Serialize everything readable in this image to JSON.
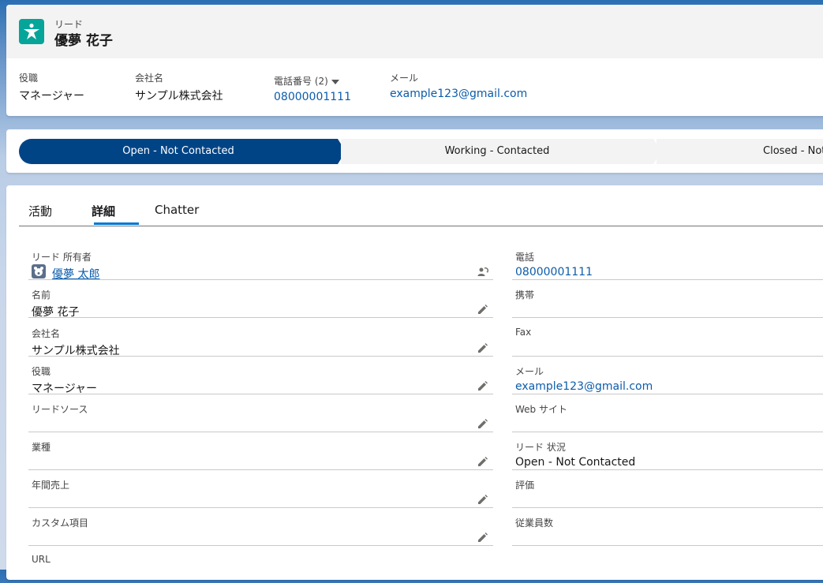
{
  "header": {
    "object_label": "リード",
    "record_name": "優夢 花子",
    "fields": [
      {
        "label": "役職",
        "value": "マネージャー"
      },
      {
        "label": "会社名",
        "value": "サンプル株式会社"
      },
      {
        "label": "電話番号 (2)",
        "value": "08000001111"
      },
      {
        "label": "メール",
        "value": "example123@gmail.com"
      }
    ]
  },
  "path": {
    "stages": [
      "Open - Not Contacted",
      "Working - Contacted",
      "Closed - Not"
    ]
  },
  "tabs": [
    "活動",
    "詳細",
    "Chatter"
  ],
  "details": {
    "left": [
      {
        "label": "リード 所有者",
        "value": "優夢 太郎"
      },
      {
        "label": "名前",
        "value": "優夢 花子"
      },
      {
        "label": "会社名",
        "value": "サンプル株式会社"
      },
      {
        "label": "役職",
        "value": "マネージャー"
      },
      {
        "label": "リードソース",
        "value": ""
      },
      {
        "label": "業種",
        "value": ""
      },
      {
        "label": "年間売上",
        "value": ""
      },
      {
        "label": "カスタム項目",
        "value": ""
      },
      {
        "label": "URL",
        "value": ""
      }
    ],
    "right": [
      {
        "label": "電話",
        "value": "08000001111"
      },
      {
        "label": "携帯",
        "value": ""
      },
      {
        "label": "Fax",
        "value": ""
      },
      {
        "label": "メール",
        "value": "example123@gmail.com"
      },
      {
        "label": "Web サイト",
        "value": ""
      },
      {
        "label": "リード 状況",
        "value": "Open - Not Contacted"
      },
      {
        "label": "評価",
        "value": ""
      },
      {
        "label": "従業員数",
        "value": ""
      }
    ]
  },
  "colors": {
    "brand_blue": "#014486",
    "link": "#0b5cab",
    "lead_icon": "#06a59a"
  }
}
